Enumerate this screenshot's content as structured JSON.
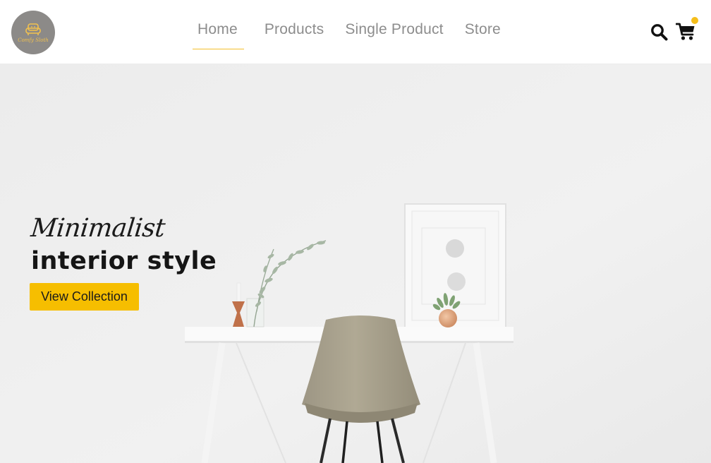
{
  "brand": {
    "logo_text": "Comfy Sloth",
    "logo_background": "#8c8a88",
    "logo_accent": "#f2c14e"
  },
  "nav": {
    "items": [
      {
        "label": "Home",
        "active": true
      },
      {
        "label": "Products",
        "active": false
      },
      {
        "label": "Single Product",
        "active": false
      },
      {
        "label": "Store",
        "active": false
      }
    ],
    "active_underline_color": "#f3bf2c",
    "icons": [
      "search-icon",
      "cart-icon"
    ],
    "cart_indicator_color": "#f5be1b"
  },
  "hero": {
    "subtitle": "Minimalist",
    "title": "interior style",
    "cta_label": "View Collection",
    "cta_color": "#f6be00"
  }
}
